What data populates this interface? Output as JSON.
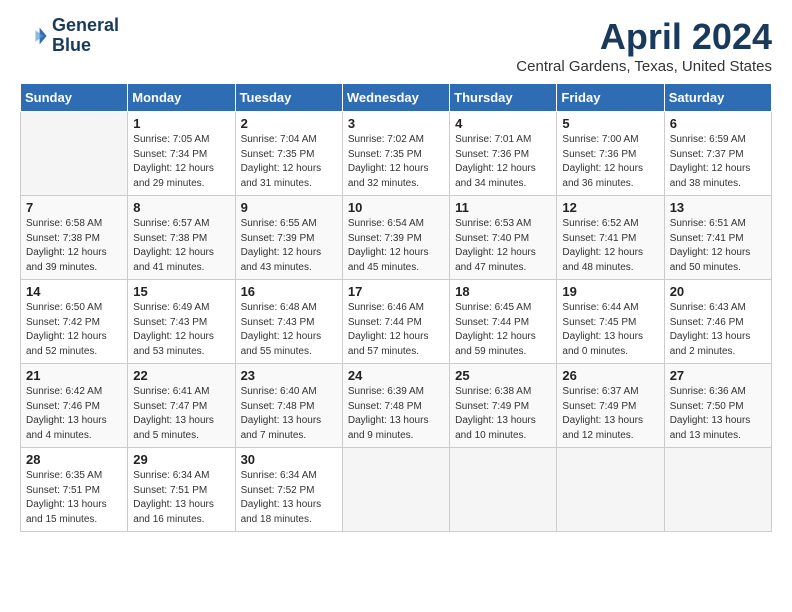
{
  "header": {
    "logo_line1": "General",
    "logo_line2": "Blue",
    "month_title": "April 2024",
    "location": "Central Gardens, Texas, United States"
  },
  "days_of_week": [
    "Sunday",
    "Monday",
    "Tuesday",
    "Wednesday",
    "Thursday",
    "Friday",
    "Saturday"
  ],
  "weeks": [
    [
      {
        "day": "",
        "empty": true
      },
      {
        "day": "1",
        "sunrise": "7:05 AM",
        "sunset": "7:34 PM",
        "daylight": "12 hours and 29 minutes."
      },
      {
        "day": "2",
        "sunrise": "7:04 AM",
        "sunset": "7:35 PM",
        "daylight": "12 hours and 31 minutes."
      },
      {
        "day": "3",
        "sunrise": "7:02 AM",
        "sunset": "7:35 PM",
        "daylight": "12 hours and 32 minutes."
      },
      {
        "day": "4",
        "sunrise": "7:01 AM",
        "sunset": "7:36 PM",
        "daylight": "12 hours and 34 minutes."
      },
      {
        "day": "5",
        "sunrise": "7:00 AM",
        "sunset": "7:36 PM",
        "daylight": "12 hours and 36 minutes."
      },
      {
        "day": "6",
        "sunrise": "6:59 AM",
        "sunset": "7:37 PM",
        "daylight": "12 hours and 38 minutes."
      }
    ],
    [
      {
        "day": "7",
        "sunrise": "6:58 AM",
        "sunset": "7:38 PM",
        "daylight": "12 hours and 39 minutes."
      },
      {
        "day": "8",
        "sunrise": "6:57 AM",
        "sunset": "7:38 PM",
        "daylight": "12 hours and 41 minutes."
      },
      {
        "day": "9",
        "sunrise": "6:55 AM",
        "sunset": "7:39 PM",
        "daylight": "12 hours and 43 minutes."
      },
      {
        "day": "10",
        "sunrise": "6:54 AM",
        "sunset": "7:39 PM",
        "daylight": "12 hours and 45 minutes."
      },
      {
        "day": "11",
        "sunrise": "6:53 AM",
        "sunset": "7:40 PM",
        "daylight": "12 hours and 47 minutes."
      },
      {
        "day": "12",
        "sunrise": "6:52 AM",
        "sunset": "7:41 PM",
        "daylight": "12 hours and 48 minutes."
      },
      {
        "day": "13",
        "sunrise": "6:51 AM",
        "sunset": "7:41 PM",
        "daylight": "12 hours and 50 minutes."
      }
    ],
    [
      {
        "day": "14",
        "sunrise": "6:50 AM",
        "sunset": "7:42 PM",
        "daylight": "12 hours and 52 minutes."
      },
      {
        "day": "15",
        "sunrise": "6:49 AM",
        "sunset": "7:43 PM",
        "daylight": "12 hours and 53 minutes."
      },
      {
        "day": "16",
        "sunrise": "6:48 AM",
        "sunset": "7:43 PM",
        "daylight": "12 hours and 55 minutes."
      },
      {
        "day": "17",
        "sunrise": "6:46 AM",
        "sunset": "7:44 PM",
        "daylight": "12 hours and 57 minutes."
      },
      {
        "day": "18",
        "sunrise": "6:45 AM",
        "sunset": "7:44 PM",
        "daylight": "12 hours and 59 minutes."
      },
      {
        "day": "19",
        "sunrise": "6:44 AM",
        "sunset": "7:45 PM",
        "daylight": "13 hours and 0 minutes."
      },
      {
        "day": "20",
        "sunrise": "6:43 AM",
        "sunset": "7:46 PM",
        "daylight": "13 hours and 2 minutes."
      }
    ],
    [
      {
        "day": "21",
        "sunrise": "6:42 AM",
        "sunset": "7:46 PM",
        "daylight": "13 hours and 4 minutes."
      },
      {
        "day": "22",
        "sunrise": "6:41 AM",
        "sunset": "7:47 PM",
        "daylight": "13 hours and 5 minutes."
      },
      {
        "day": "23",
        "sunrise": "6:40 AM",
        "sunset": "7:48 PM",
        "daylight": "13 hours and 7 minutes."
      },
      {
        "day": "24",
        "sunrise": "6:39 AM",
        "sunset": "7:48 PM",
        "daylight": "13 hours and 9 minutes."
      },
      {
        "day": "25",
        "sunrise": "6:38 AM",
        "sunset": "7:49 PM",
        "daylight": "13 hours and 10 minutes."
      },
      {
        "day": "26",
        "sunrise": "6:37 AM",
        "sunset": "7:49 PM",
        "daylight": "13 hours and 12 minutes."
      },
      {
        "day": "27",
        "sunrise": "6:36 AM",
        "sunset": "7:50 PM",
        "daylight": "13 hours and 13 minutes."
      }
    ],
    [
      {
        "day": "28",
        "sunrise": "6:35 AM",
        "sunset": "7:51 PM",
        "daylight": "13 hours and 15 minutes."
      },
      {
        "day": "29",
        "sunrise": "6:34 AM",
        "sunset": "7:51 PM",
        "daylight": "13 hours and 16 minutes."
      },
      {
        "day": "30",
        "sunrise": "6:34 AM",
        "sunset": "7:52 PM",
        "daylight": "13 hours and 18 minutes."
      },
      {
        "day": "",
        "empty": true
      },
      {
        "day": "",
        "empty": true
      },
      {
        "day": "",
        "empty": true
      },
      {
        "day": "",
        "empty": true
      }
    ]
  ]
}
